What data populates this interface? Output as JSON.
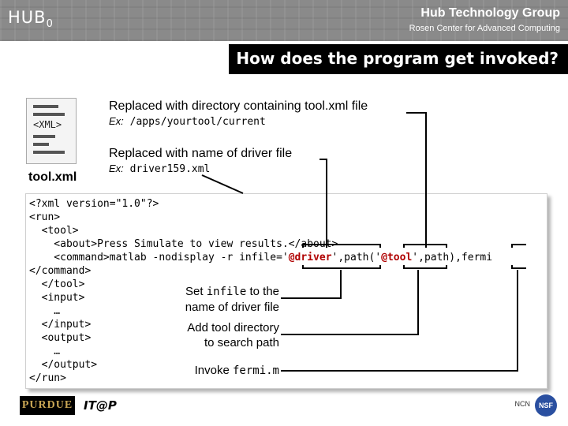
{
  "header": {
    "logo_main": "HUB",
    "logo_sub": "0",
    "group_title": "Hub Technology Group",
    "group_subtitle": "Rosen Center for Advanced Computing"
  },
  "slide": {
    "title": "How does the program get invoked?"
  },
  "icon": {
    "doc_xml": "<XML>",
    "label": "tool.xml"
  },
  "annotations": {
    "dir_caption": "Replaced with directory containing tool.xml file",
    "dir_example_prefix": "Ex:",
    "dir_example": "/apps/yourtool/current",
    "driver_caption": "Replaced with name of driver file",
    "driver_example_prefix": "Ex:",
    "driver_example": "driver159.xml"
  },
  "code": {
    "line1": "<?xml version=\"1.0\"?>",
    "line2": "<run>",
    "line3": "  <tool>",
    "line4": "    <about>Press Simulate to view results.</about>",
    "line5_a": "    <command>matlab -nodisplay -r infile='",
    "line5_hl1": "@driver",
    "line5_b": "',path('",
    "line5_hl2": "@tool",
    "line5_c": "',path),fermi",
    "line6": "</command>",
    "line7": "  </tool>",
    "line8": "  <input>",
    "line9": "    …",
    "line10": "  </input>",
    "line11": "  <output>",
    "line12": "    …",
    "line13": "  </output>",
    "line14": "</run>"
  },
  "notes": {
    "set_prefix": "Set",
    "set_code": "infile",
    "set_suffix": "to the",
    "set_line2": "name of driver file",
    "add_line1": "Add tool directory",
    "add_line2": "to search path",
    "invoke_prefix": "Invoke",
    "invoke_code": "fermi.m"
  },
  "footer": {
    "purdue": "PURDUE",
    "itap": "IT@P",
    "ncn": "NCN",
    "nsf": "NSF"
  },
  "colors": {
    "header_bg": "#8a8a8a",
    "title_bar": "#000000",
    "highlight": "#b00000"
  }
}
